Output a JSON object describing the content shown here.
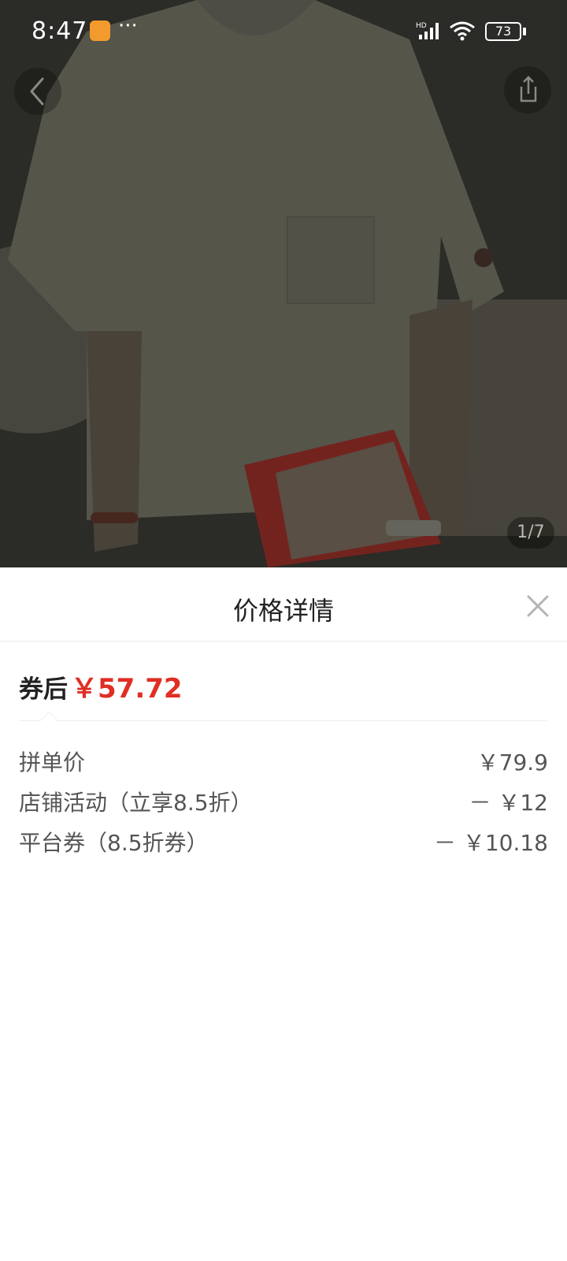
{
  "status_bar": {
    "time": "8:47",
    "more": "···",
    "network_label": "HD",
    "battery_level": "73"
  },
  "gallery": {
    "page_indicator": "1/7"
  },
  "price_sheet": {
    "title": "价格详情",
    "total_label": "券后",
    "total_value": "￥57.72",
    "lines": [
      {
        "label": "拼单价",
        "value": "￥79.9"
      },
      {
        "label": "店铺活动（立享8.5折）",
        "value": "－ ￥12"
      },
      {
        "label": "平台券（8.5折券）",
        "value": "－ ￥10.18"
      }
    ]
  },
  "colors": {
    "price_red": "#e02e24",
    "text_dark": "#222222",
    "text_gray": "#555555"
  },
  "icons": [
    "back-icon",
    "share-icon",
    "close-icon",
    "signal-icon",
    "wifi-icon",
    "battery-icon",
    "app-notification-icon"
  ]
}
